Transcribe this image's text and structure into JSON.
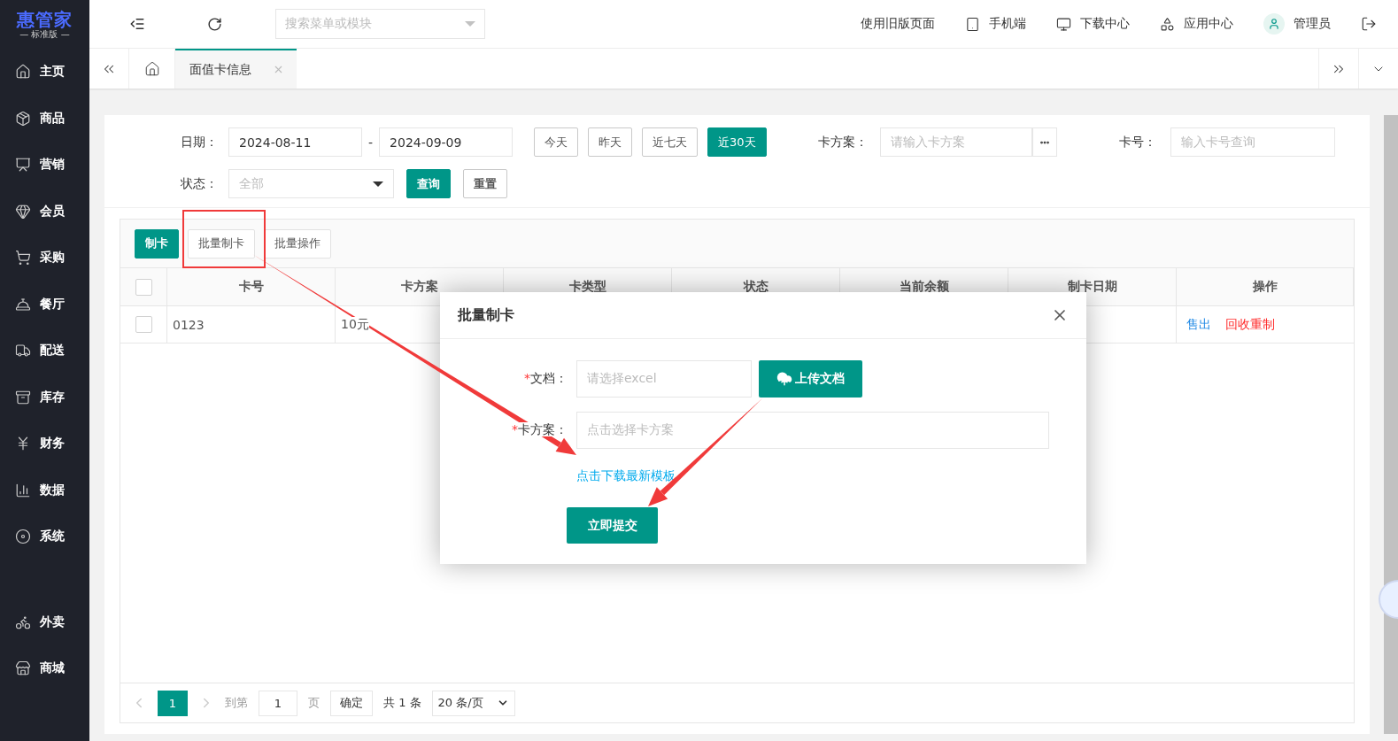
{
  "brand": {
    "name": "惠管家",
    "edition": "— 标准版 —"
  },
  "sidebar": {
    "items": [
      {
        "label": "主页"
      },
      {
        "label": "商品"
      },
      {
        "label": "营销"
      },
      {
        "label": "会员"
      },
      {
        "label": "采购"
      },
      {
        "label": "餐厅"
      },
      {
        "label": "配送"
      },
      {
        "label": "库存"
      },
      {
        "label": "财务"
      },
      {
        "label": "数据"
      },
      {
        "label": "系统"
      }
    ],
    "bottom_items": [
      {
        "label": "外卖"
      },
      {
        "label": "商城"
      }
    ]
  },
  "topbar": {
    "search_placeholder": "搜索菜单或模块",
    "links": [
      {
        "label": "使用旧版页面"
      },
      {
        "label": "手机端"
      },
      {
        "label": "下载中心"
      },
      {
        "label": "应用中心"
      },
      {
        "label": "管理员"
      }
    ]
  },
  "tabs": [
    {
      "label": "面值卡信息",
      "selected": true
    }
  ],
  "filters": {
    "date_label": "日期：",
    "date_start": "2024-08-11",
    "date_sep": "-",
    "date_end": "2024-09-09",
    "ranges": [
      {
        "label": "今天",
        "selected": false
      },
      {
        "label": "昨天",
        "selected": false
      },
      {
        "label": "近七天",
        "selected": false
      },
      {
        "label": "近30天",
        "selected": true
      }
    ],
    "scheme_label": "卡方案：",
    "scheme_placeholder": "请输入卡方案",
    "card_label": "卡号：",
    "card_placeholder": "输入卡号查询",
    "status_label": "状态：",
    "status_value": "全部",
    "query": "查询",
    "reset": "重置"
  },
  "toolbar": [
    {
      "label": "制卡",
      "kind": "primary"
    },
    {
      "label": "批量制卡",
      "kind": "default"
    },
    {
      "label": "批量操作",
      "kind": "default"
    }
  ],
  "table": {
    "select_all_checked": false,
    "columns": [
      "卡号",
      "卡方案",
      "卡类型",
      "状态",
      "当前余额",
      "制卡日期",
      "操作"
    ],
    "rows": [
      {
        "checked": false,
        "card_no": "0123",
        "scheme": "10元",
        "actions": [
          {
            "label": "售出",
            "color": "#1e88e5"
          },
          {
            "label": "回收重制",
            "color": "#ff2b2b"
          }
        ]
      }
    ]
  },
  "pagination": {
    "current": "1",
    "goto": "到第",
    "page_input": "1",
    "page_unit": "页",
    "confirm": "确定",
    "total": "共 1 条",
    "page_size": "20 条/页"
  },
  "dialog": {
    "title": "批量制卡",
    "fields": [
      {
        "mark": "*",
        "label": "文档：",
        "placeholder": "请选择excel",
        "button": "上传文档"
      },
      {
        "mark": "*",
        "label": "卡方案：",
        "placeholder": "点击选择卡方案"
      }
    ],
    "link": "点击下载最新模板",
    "submit": "立即提交"
  }
}
